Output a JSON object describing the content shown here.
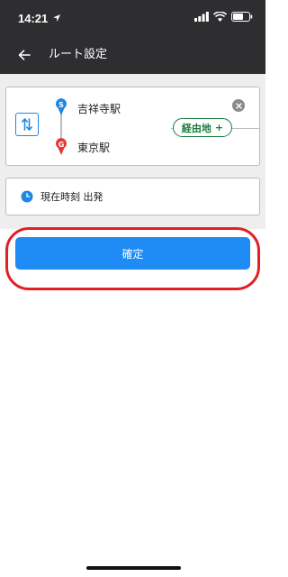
{
  "status_bar": {
    "time": "14:21"
  },
  "header": {
    "title": "ルート設定"
  },
  "route": {
    "start_station": "吉祥寺駅",
    "goal_station": "東京駅",
    "start_marker": "S",
    "goal_marker": "G",
    "via_label": "経由地",
    "via_plus": "+"
  },
  "time_setting": {
    "label": "現在時刻 出発"
  },
  "confirm": {
    "label": "確定"
  },
  "colors": {
    "header_bg": "#2e2e30",
    "accent_blue": "#1e8cf4",
    "start_pin": "#1e88e5",
    "goal_pin": "#e53935",
    "via_green": "#1a7d3b",
    "highlight_red": "#e12025"
  },
  "icons": {
    "location": "location-arrow-icon",
    "signal": "signal-icon",
    "wifi": "wifi-icon",
    "battery": "battery-icon",
    "back": "arrow-left-icon",
    "swap": "swap-icon",
    "clear": "close-icon",
    "clock": "clock-icon"
  }
}
